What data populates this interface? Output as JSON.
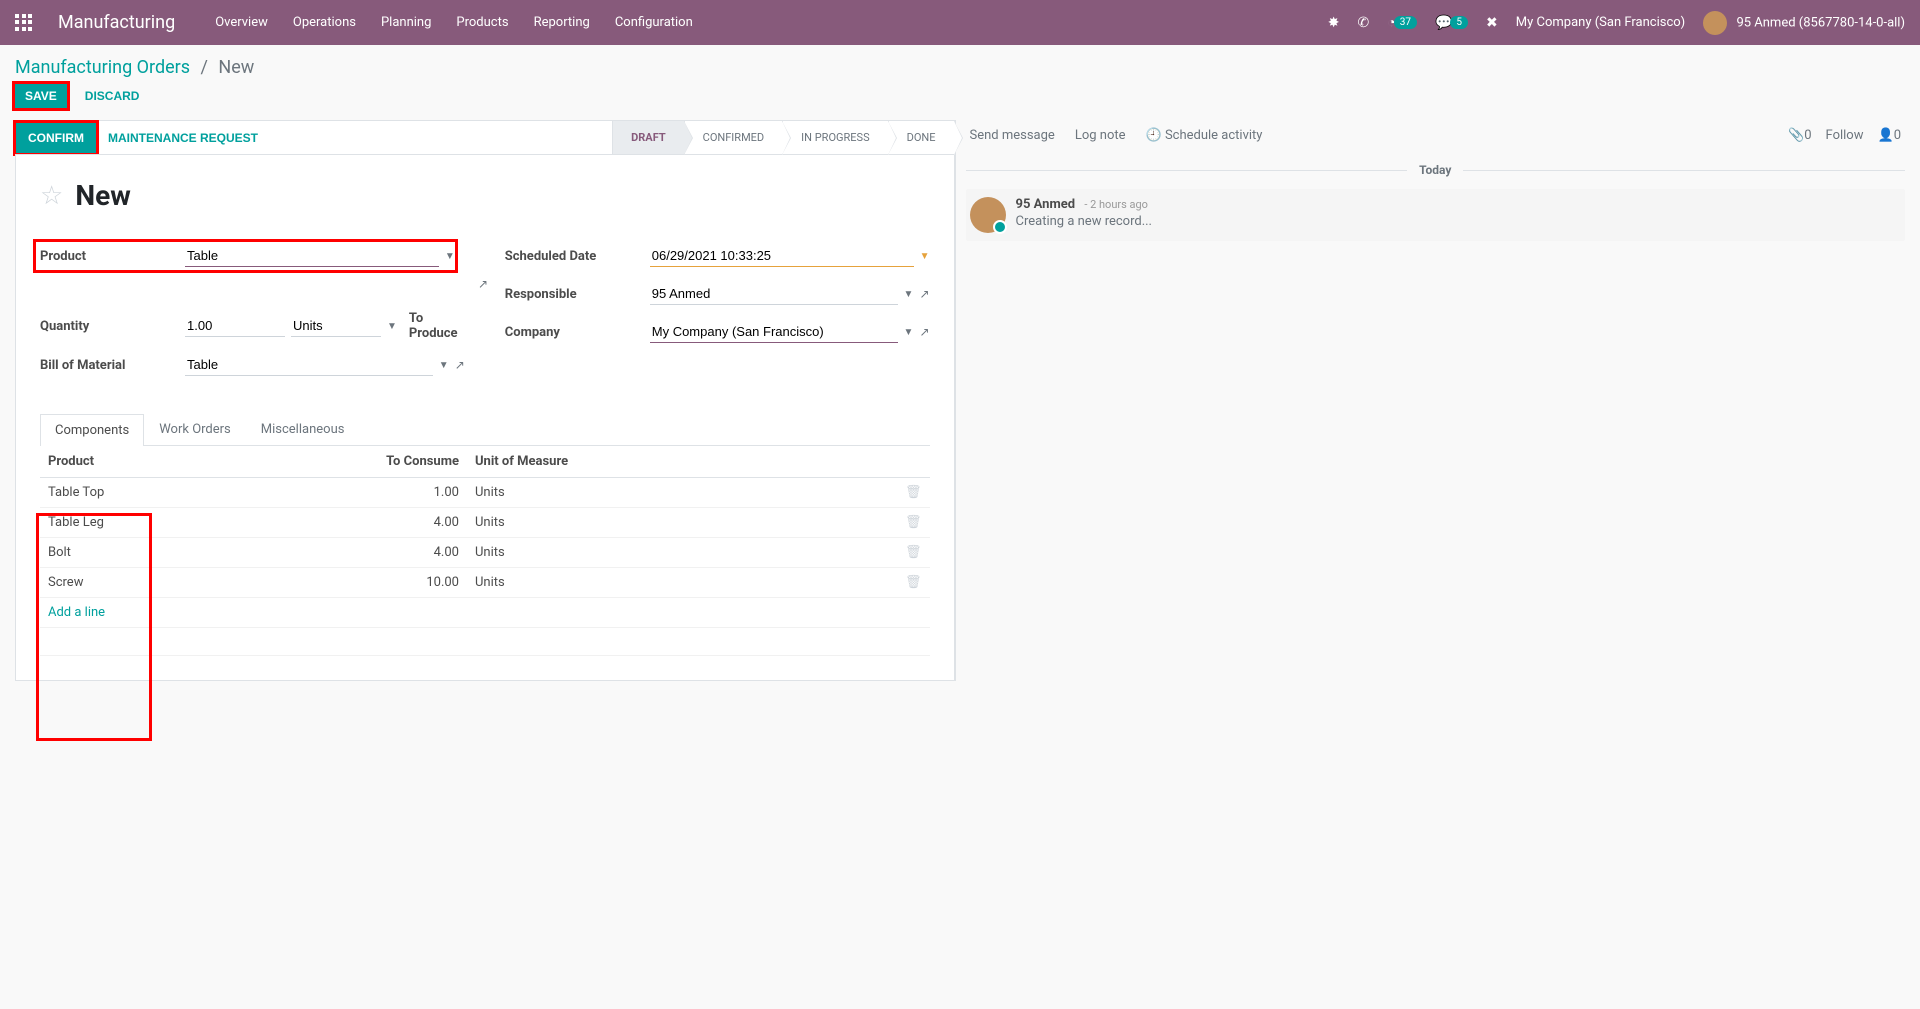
{
  "nav": {
    "brand": "Manufacturing",
    "menu": [
      "Overview",
      "Operations",
      "Planning",
      "Products",
      "Reporting",
      "Configuration"
    ],
    "clock_badge": "37",
    "chat_badge": "5",
    "company": "My Company (San Francisco)",
    "user": "95 Anmed (8567780-14-0-all)"
  },
  "breadcrumb": {
    "root": "Manufacturing Orders",
    "current": "New"
  },
  "actions": {
    "save": "SAVE",
    "discard": "DISCARD"
  },
  "workflow": {
    "confirm": "CONFIRM",
    "maintenance": "MAINTENANCE REQUEST",
    "steps": [
      "DRAFT",
      "CONFIRMED",
      "IN PROGRESS",
      "DONE"
    ],
    "active": "DRAFT"
  },
  "title": "New",
  "fields": {
    "product_label": "Product",
    "product": "Table",
    "quantity_label": "Quantity",
    "quantity": "1.00",
    "uom": "Units",
    "to_produce": "To Produce",
    "bom_label": "Bill of Material",
    "bom": "Table",
    "sched_label": "Scheduled Date",
    "sched": "06/29/2021 10:33:25",
    "resp_label": "Responsible",
    "resp": "95 Anmed",
    "company_label": "Company",
    "company": "My Company (San Francisco)"
  },
  "tabs": [
    "Components",
    "Work Orders",
    "Miscellaneous"
  ],
  "components": {
    "headers": {
      "product": "Product",
      "to_consume": "To Consume",
      "uom": "Unit of Measure"
    },
    "rows": [
      {
        "product": "Table Top",
        "qty": "1.00",
        "uom": "Units"
      },
      {
        "product": "Table Leg",
        "qty": "4.00",
        "uom": "Units"
      },
      {
        "product": "Bolt",
        "qty": "4.00",
        "uom": "Units"
      },
      {
        "product": "Screw",
        "qty": "10.00",
        "uom": "Units"
      }
    ],
    "add_line": "Add a line"
  },
  "chatter": {
    "send": "Send message",
    "log": "Log note",
    "schedule": "Schedule activity",
    "attach_count": "0",
    "follow": "Follow",
    "follower_count": "0",
    "today": "Today",
    "msg": {
      "author": "95 Anmed",
      "time": "- 2 hours ago",
      "text": "Creating a new record..."
    }
  }
}
